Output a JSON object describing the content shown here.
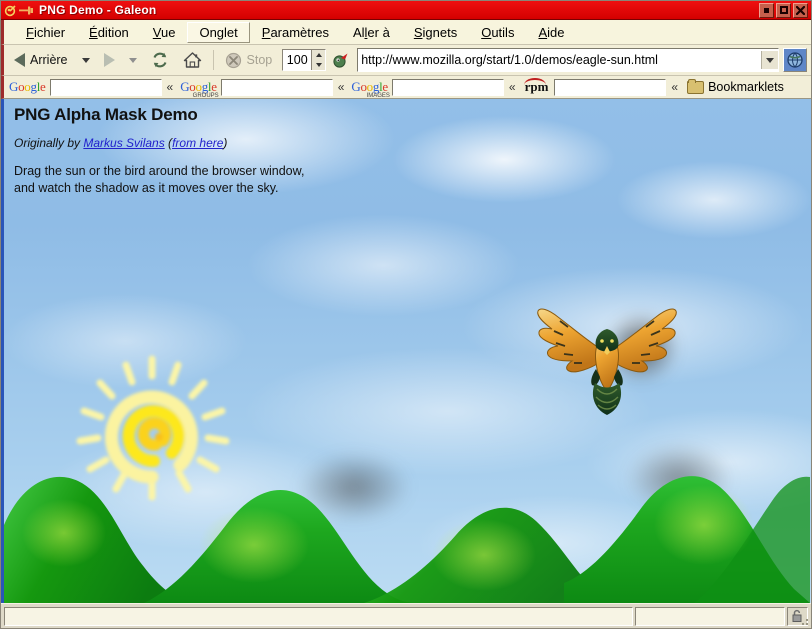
{
  "window": {
    "title": "PNG Demo - Galeon",
    "icon": "galeon-icon",
    "pin_icon": "pin-icon",
    "controls": {
      "minimize": "minimize-button",
      "maximize": "maximize-button",
      "close": "close-button"
    }
  },
  "menubar": {
    "items": [
      {
        "label": "Fichier",
        "accel": "F"
      },
      {
        "label": "Édition",
        "accel": "É"
      },
      {
        "label": "Vue",
        "accel": "V"
      },
      {
        "label": "Onglet",
        "accel": "g",
        "raised": true
      },
      {
        "label": "Paramètres",
        "accel": "P"
      },
      {
        "label": "Aller à",
        "accel": "l"
      },
      {
        "label": "Signets",
        "accel": "S"
      },
      {
        "label": "Outils",
        "accel": "O"
      },
      {
        "label": "Aide",
        "accel": "A"
      }
    ]
  },
  "toolbar": {
    "back_label": "Arrière",
    "back_icon": "back-arrow-icon",
    "back_dropdown_icon": "chevron-down-icon",
    "forward_icon": "forward-arrow-icon",
    "forward_dropdown_icon": "chevron-down-icon",
    "reload_icon": "reload-icon",
    "home_icon": "home-icon",
    "stop_icon": "stop-icon",
    "stop_label": "Stop",
    "stop_enabled": false,
    "zoom_value": "100",
    "zoom_up_icon": "spinner-up-icon",
    "zoom_down_icon": "spinner-down-icon",
    "favicon": "mozilla-favicon",
    "url_value": "http://www.mozilla.org/start/1.0/demos/eagle-sun.html",
    "url_placeholder": "",
    "url_dropdown_icon": "chevron-down-icon",
    "go_icon": "go-globe-icon"
  },
  "bookmarkbar": {
    "entries": [
      {
        "logo": "Google",
        "sub": "",
        "field_value": "",
        "field_placeholder": "",
        "chevron": "«"
      },
      {
        "logo": "Google",
        "sub": "GROUPS",
        "field_value": "",
        "field_placeholder": "",
        "chevron": "«"
      },
      {
        "logo": "Google",
        "sub": "IMAGES",
        "field_value": "",
        "field_placeholder": "",
        "chevron": "«"
      },
      {
        "logo": "rpm",
        "sub": "",
        "field_value": "",
        "field_placeholder": "",
        "chevron": "«"
      }
    ],
    "folder_label": "Bookmarklets",
    "folder_icon": "folder-icon"
  },
  "page": {
    "title": "PNG Alpha Mask Demo",
    "credit_prefix": "Originally by ",
    "credit_author": "Markus Svilans",
    "credit_open_paren": " (",
    "credit_link": "from here",
    "credit_close_paren": ")",
    "desc_line1": "Drag the sun or the bird around the browser window,",
    "desc_line2": "and watch the shadow as it moves over the sky.",
    "sun_alt": "sun-image",
    "bird_alt": "eagle-image",
    "hills_alt": "green-hills-image"
  },
  "statusbar": {
    "message": "",
    "progress_value": "",
    "lock_icon": "unlocked-padlock-icon",
    "resizer_icon": "resize-grip-icon"
  },
  "colors": {
    "titlebar": "#e00000",
    "chrome": "#f2eed8",
    "accent_blue": "#2a55b8",
    "sky": "#93bfe8",
    "hill_green": "#19a019",
    "link": "#2222cc"
  }
}
